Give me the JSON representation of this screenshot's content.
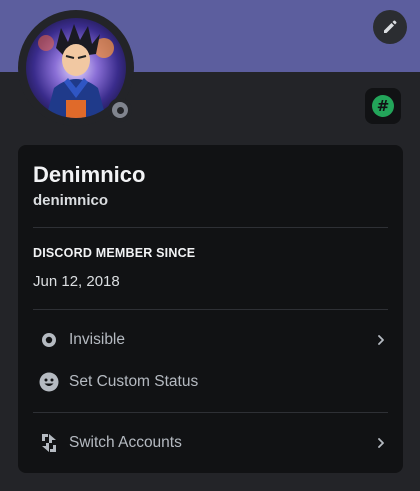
{
  "profile": {
    "display_name": "Denimnico",
    "username": "denimnico",
    "member_since_title": "DISCORD MEMBER SINCE",
    "member_since_date": "Jun 12, 2018",
    "status": "invisible"
  },
  "menu": {
    "status_label": "Invisible",
    "custom_status_label": "Set Custom Status",
    "switch_accounts_label": "Switch Accounts"
  },
  "colors": {
    "banner": "#5c5e9e",
    "background": "#232428",
    "card": "#111214",
    "badge_green": "#23a55a",
    "status_gray": "#80848e"
  },
  "icons": {
    "edit": "pencil-icon",
    "badge": "hashtag-badge-icon",
    "status": "invisible-status-icon",
    "custom_status": "smiley-icon",
    "switch": "switch-accounts-icon",
    "chevron": "chevron-right-icon"
  }
}
